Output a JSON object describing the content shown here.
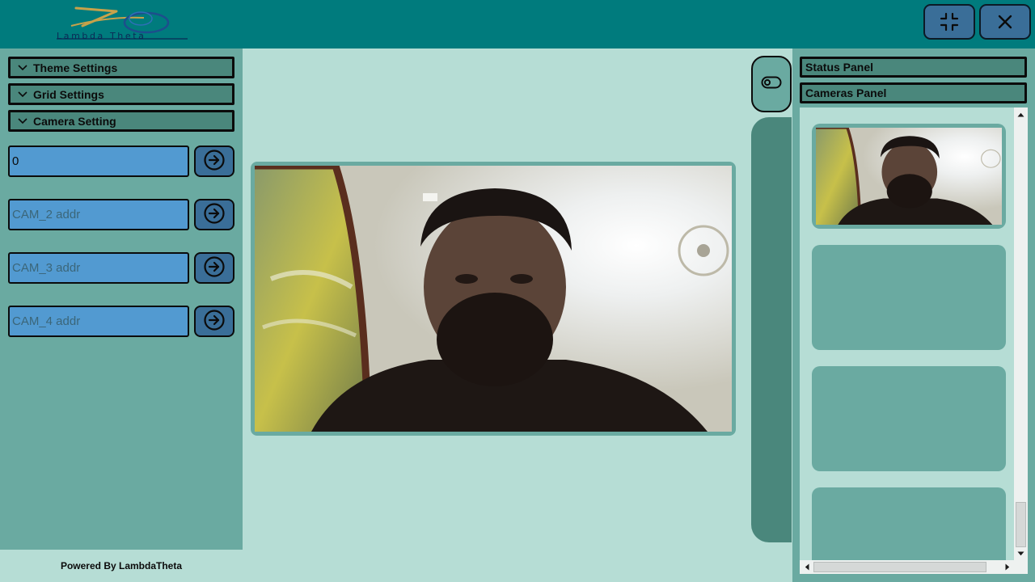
{
  "app": {
    "logo_text": "Lambda Theta",
    "colors": {
      "topbar": "#007b7d",
      "panel": "#6aaaa1",
      "panel_dark": "#4a877c",
      "background": "#b6ddd5",
      "button": "#3a6e98",
      "input": "#529ad1"
    }
  },
  "window_controls": {
    "minimize_icon": "compress-icon",
    "close_icon": "close-icon"
  },
  "left_panel": {
    "accordions": [
      {
        "label": "Theme Settings",
        "icon": "chevron-down-icon"
      },
      {
        "label": "Grid Settings",
        "icon": "chevron-down-icon"
      },
      {
        "label": "Camera Setting",
        "icon": "chevron-down-icon"
      }
    ],
    "camera_inputs": [
      {
        "value": "0",
        "placeholder": "",
        "button_icon": "arrow-right-circle-icon"
      },
      {
        "value": "",
        "placeholder": "CAM_2 addr",
        "button_icon": "arrow-right-circle-icon"
      },
      {
        "value": "",
        "placeholder": "CAM_3 addr",
        "button_icon": "arrow-right-circle-icon"
      },
      {
        "value": "",
        "placeholder": "CAM_4 addr",
        "button_icon": "arrow-right-circle-icon"
      }
    ],
    "footer": "Powered By LambdaTheta"
  },
  "center": {
    "toggle_icon": "toggle-icon"
  },
  "right_panel": {
    "status_panel_label": "Status Panel",
    "cameras_panel_label": "Cameras Panel"
  }
}
